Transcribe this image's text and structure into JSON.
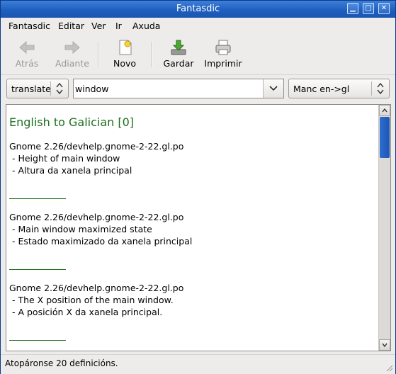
{
  "window": {
    "title": "Fantasdic"
  },
  "menubar": {
    "items": [
      "Fantasdic",
      "Editar",
      "Ver",
      "Ir",
      "Axuda"
    ]
  },
  "toolbar": {
    "back_label": "Atrás",
    "forward_label": "Adiante",
    "new_label": "Novo",
    "save_label": "Gardar",
    "print_label": "Imprimir"
  },
  "search": {
    "mode_value": "translate",
    "query_value": "window",
    "dictionary_value": "Manc en->gl"
  },
  "results": {
    "heading": "English to Galician [0]",
    "entries": [
      {
        "source": "Gnome 2.26/devhelp.gnome-2-22.gl.po",
        "original": " - Height of main window",
        "translation": " - Altura da xanela principal"
      },
      {
        "source": "Gnome 2.26/devhelp.gnome-2-22.gl.po",
        "original": " - Main window maximized state",
        "translation": " - Estado maximizado da xanela principal"
      },
      {
        "source": "Gnome 2.26/devhelp.gnome-2-22.gl.po",
        "original": " - The X position of the main window.",
        "translation": " - A posición X da xanela principal."
      }
    ]
  },
  "statusbar": {
    "text": "Atopáronse 20 definicións."
  },
  "colors": {
    "heading": "#1d6e1d",
    "titlebar": "#1f5fbf",
    "scroll_thumb": "#2d6fd0"
  },
  "scroll": {
    "position_fraction": 0.0
  }
}
